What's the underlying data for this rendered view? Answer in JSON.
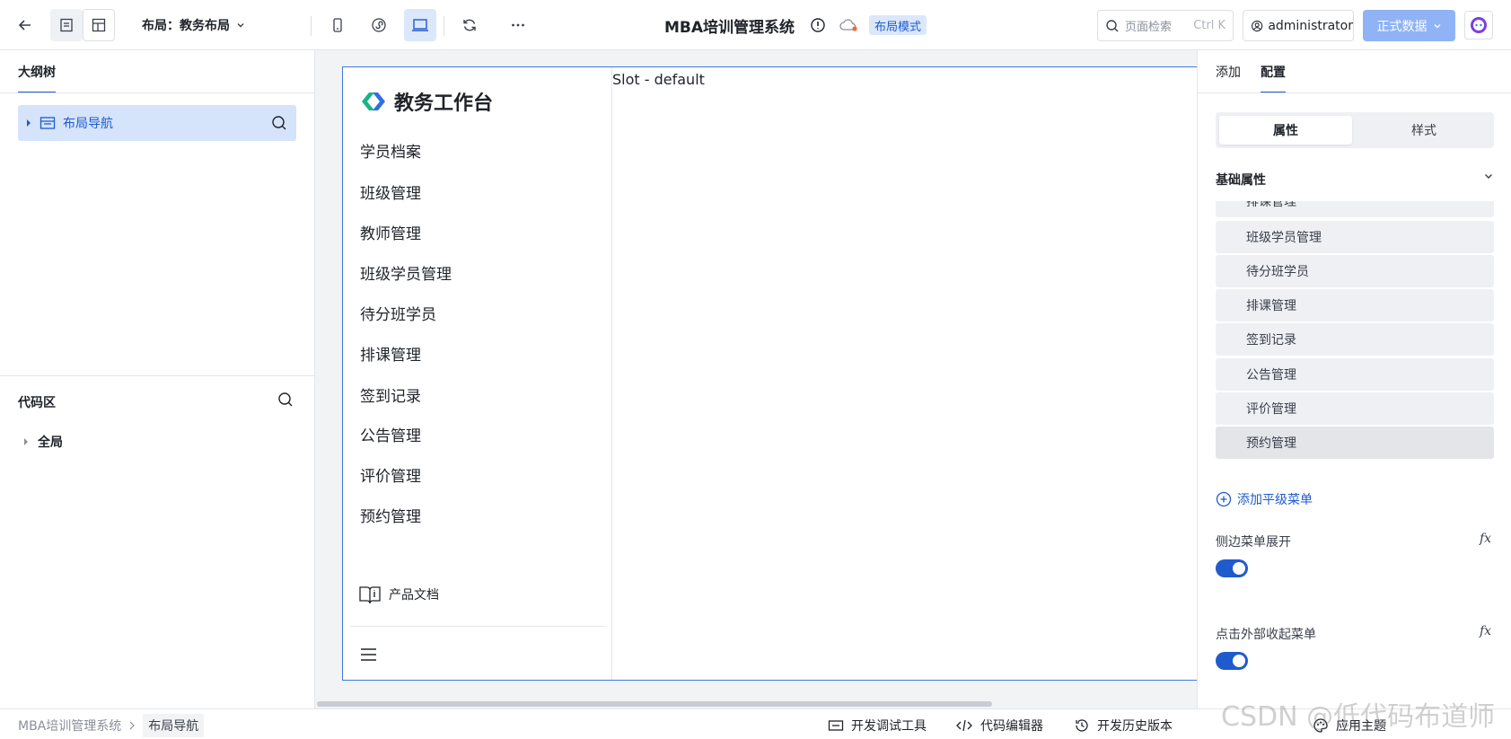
{
  "toolbar": {
    "layout_label": "布局：教务布局",
    "app_title": "MBA培训管理系统",
    "mode_badge": "布局模式",
    "search_placeholder": "页面检索",
    "search_shortcut": "Ctrl K",
    "user": "administrator",
    "data_env": "正式数据"
  },
  "left_panel": {
    "tab": "大纲树",
    "tree_item": "布局导航",
    "code_title": "代码区",
    "code_item": "全局"
  },
  "canvas": {
    "logo_text": "教务工作台",
    "nav_items": [
      "学员档案",
      "班级管理",
      "教师管理",
      "班级学员管理",
      "待分班学员",
      "排课管理",
      "签到记录",
      "公告管理",
      "评价管理",
      "预约管理"
    ],
    "doc_link": "产品文档",
    "slot_text": "Slot - default"
  },
  "right_panel": {
    "tabs": [
      "添加",
      "配置"
    ],
    "active_tab": "配置",
    "seg_options": [
      "属性",
      "样式"
    ],
    "section_title": "基础属性",
    "partial_item": "排课管理",
    "menu_items": [
      "班级学员管理",
      "待分班学员",
      "排课管理",
      "签到记录",
      "公告管理",
      "评价管理",
      "预约管理"
    ],
    "add_menu": "添加平级菜单",
    "prop1_label": "侧边菜单展开",
    "prop1_value": true,
    "prop2_label": "点击外部收起菜单",
    "prop2_value": true,
    "fx_label": "fx"
  },
  "statusbar": {
    "crumbs": [
      "MBA培训管理系统",
      "布局导航"
    ],
    "tools": [
      "开发调试工具",
      "代码编辑器",
      "开发历史版本",
      "应用主题"
    ]
  },
  "watermark": "CSDN @低代码布道师",
  "colors": {
    "accent": "#1f5bcc",
    "selected_bg": "#d5e3fb",
    "data_button": "#8fb3f5"
  }
}
